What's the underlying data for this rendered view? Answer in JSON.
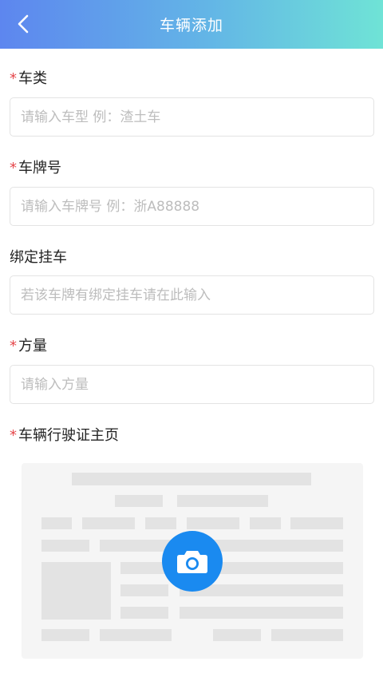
{
  "header": {
    "title": "车辆添加",
    "back_icon": "chevron-left-icon"
  },
  "form": {
    "vehicle_type": {
      "required_mark": "*",
      "label": "车类",
      "placeholder": "请输入车型 例：渣土车",
      "value": ""
    },
    "plate_number": {
      "required_mark": "*",
      "label": "车牌号",
      "placeholder": "请输入车牌号 例：浙A88888",
      "value": ""
    },
    "trailer": {
      "label": "绑定挂车",
      "placeholder": "若该车牌有绑定挂车请在此输入",
      "value": ""
    },
    "volume": {
      "required_mark": "*",
      "label": "方量",
      "placeholder": "请输入方量",
      "value": ""
    },
    "license_photo": {
      "required_mark": "*",
      "label": "车辆行驶证主页",
      "icon": "camera-icon"
    }
  },
  "colors": {
    "header_gradient_start": "#5d86ef",
    "header_gradient_end": "#6fe3d6",
    "required": "#e5474b",
    "camera_button": "#1a8af0"
  }
}
